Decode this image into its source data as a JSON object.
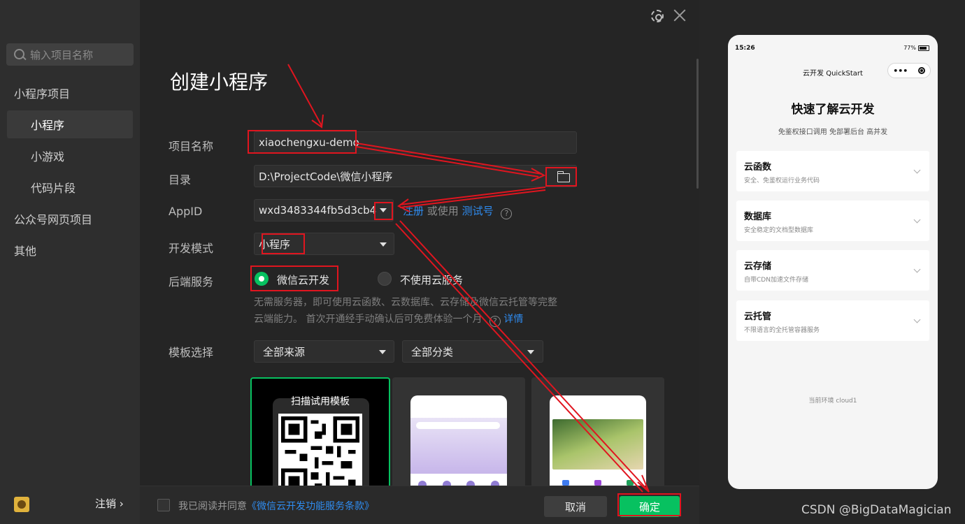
{
  "sidebar": {
    "search_placeholder": "输入项目名称",
    "items": [
      {
        "label": "小程序项目"
      },
      {
        "label": "小程序"
      },
      {
        "label": "小游戏"
      },
      {
        "label": "代码片段"
      },
      {
        "label": "公众号网页项目"
      },
      {
        "label": "其他"
      }
    ],
    "logout": "注销 ›"
  },
  "form": {
    "title": "创建小程序",
    "project_name_label": "项目名称",
    "project_name_value": "xiaochengxu-demo",
    "dir_label": "目录",
    "dir_value": "D:\\ProjectCode\\微信小程序",
    "appid_label": "AppID",
    "appid_value": "wxd3483344fb5d3cb4",
    "appid_register": "注册",
    "appid_or": "或使用",
    "appid_test": "测试号",
    "mode_label": "开发模式",
    "mode_value": "小程序",
    "backend_label": "后端服务",
    "backend_opt1": "微信云开发",
    "backend_opt2": "不使用云服务",
    "backend_desc1": "无需服务器，即可使用云函数、云数据库、云存储及微信云托管等完整",
    "backend_desc2": "云端能力。 首次开通经手动确认后可免费体验一个月",
    "backend_detail": "详情",
    "template_label": "模板选择",
    "template_source": "全部来源",
    "template_category": "全部分类",
    "template_scan_caption": "扫描试用模板"
  },
  "footer": {
    "agree_text": "我已阅读并同意",
    "agree_link": "《微信云开发功能服务条款》",
    "cancel": "取消",
    "ok": "确定"
  },
  "preview": {
    "time": "15:26",
    "battery": "77%",
    "nav_title": "云开发 QuickStart",
    "capsule_menu": "•••",
    "title": "快速了解云开发",
    "subtitle": "免鉴权接口调用 免部署后台 高并发",
    "cards": [
      {
        "title": "云函数",
        "desc": "安全、免鉴权运行业务代码"
      },
      {
        "title": "数据库",
        "desc": "安全稳定的文档型数据库"
      },
      {
        "title": "云存储",
        "desc": "自带CDN加速文件存储"
      },
      {
        "title": "云托管",
        "desc": "不限语言的全托管容器服务"
      }
    ],
    "env": "当前环境 cloud1"
  },
  "watermark": "CSDN @BigDataMagician"
}
